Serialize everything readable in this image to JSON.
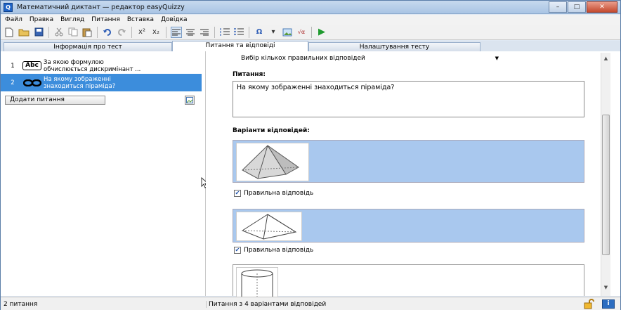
{
  "window": {
    "title": "Математичний диктант — редактор easyQuizzy",
    "app_icon": "Q",
    "minimize": "–",
    "maximize": "□",
    "close": "✕"
  },
  "menu": [
    "Файл",
    "Правка",
    "Вигляд",
    "Питання",
    "Вставка",
    "Довідка"
  ],
  "toolbar": {
    "superscript": "x²",
    "subscript": "x₂",
    "omega": "Ω",
    "omega_dd": "▾",
    "formula": "√α",
    "run": "▶"
  },
  "tabs": [
    "Інформація про тест",
    "Питання та відповіді",
    "Налаштування тесту"
  ],
  "questions": [
    {
      "num": "1",
      "icon": "Abc",
      "text_l1": "За якою формулою",
      "text_l2": "обчислюється дискримінант ..."
    },
    {
      "num": "2",
      "icon": "∞",
      "text_l1": "На якому зображенні",
      "text_l2": "знаходиться піраміда?"
    }
  ],
  "add_question_label": "Додати питання",
  "question_type": {
    "value": "Вибір кількох правильних відповідей"
  },
  "question_label": "Питання:",
  "question_text": "На якому зображенні знаходиться піраміда?",
  "answers_label": "Варіанти відповідей:",
  "answers": [
    {
      "correct_label": "Правильна відповідь",
      "checked": true
    },
    {
      "correct_label": "Правильна відповідь",
      "checked": true
    }
  ],
  "status": {
    "count": "2 питання",
    "info": "Питання з 4 варіантами відповідей"
  },
  "colors": {
    "selected": "#3c8ddc",
    "answer_bg": "#a9c8ee"
  }
}
